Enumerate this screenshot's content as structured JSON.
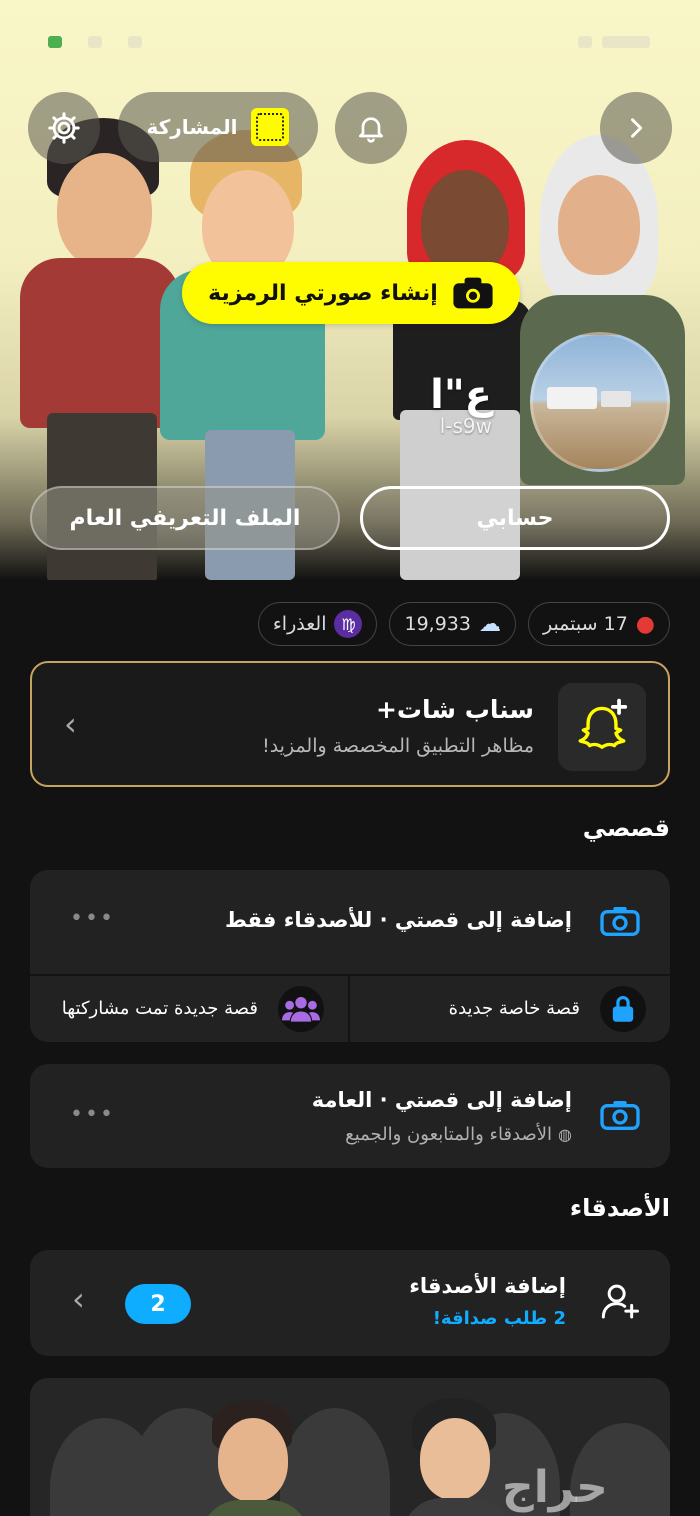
{
  "header": {
    "share_label": "المشاركة",
    "create_bitmoji_label": "إنشاء صورتي الرمزية",
    "display_name": "ع\"ا",
    "username": "l-s9w",
    "my_account_label": "حسابي",
    "public_profile_label": "الملف التعريفي العام"
  },
  "chips": {
    "birthday": "17 سبتمبر",
    "snap_score": "19,933",
    "zodiac": "العذراء"
  },
  "snapchat_plus": {
    "title": "سناب شات+",
    "subtitle": "مظاهر التطبيق المخصصة والمزيد!"
  },
  "my_stories": {
    "section_title": "قصصي",
    "add_friends_story": "إضافة إلى قصتي · للأصدقاء فقط",
    "new_private_story": "قصة خاصة جديدة",
    "new_shared_story": "قصة جديدة تمت مشاركتها",
    "add_public_story": "إضافة إلى قصتي · العامة",
    "public_story_audience": "الأصدقاء والمتابعون والجميع"
  },
  "friends": {
    "section_title": "الأصدقاء",
    "add_friends": "إضافة الأصدقاء",
    "requests": "2 طلب صداقة!",
    "badge_count": "2"
  },
  "watermark": "حراج",
  "colors": {
    "snap_yellow": "#fffc00",
    "accent_blue": "#0fadff",
    "plus_gold": "#c9a460",
    "background": "#121212"
  }
}
